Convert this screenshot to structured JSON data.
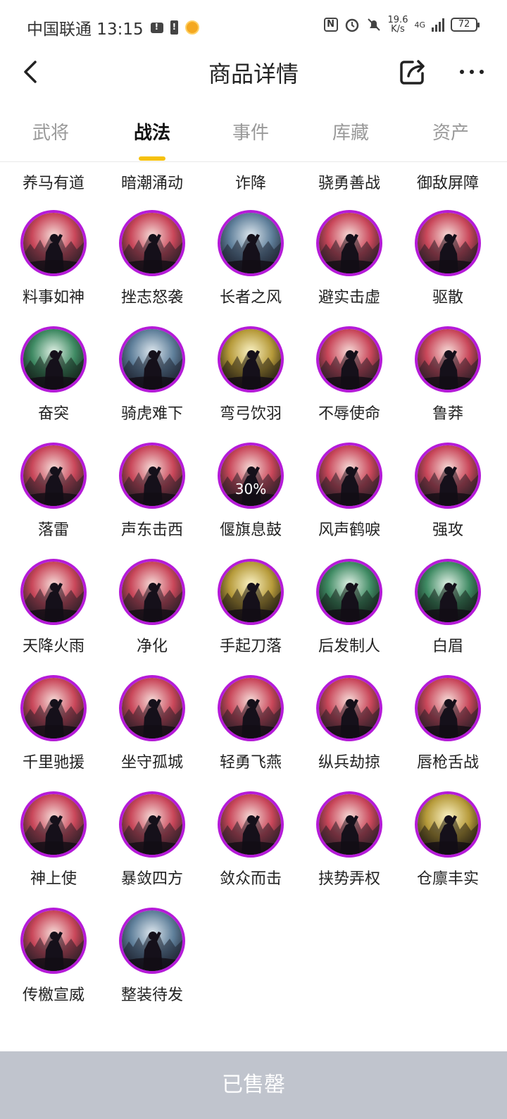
{
  "status_bar": {
    "carrier_time": "中国联通 13:15",
    "speed_value": "19.6",
    "speed_unit": "K/s",
    "network": "4G",
    "battery": "72"
  },
  "header": {
    "title": "商品详情"
  },
  "tabs": [
    {
      "label": "武将"
    },
    {
      "label": "战法"
    },
    {
      "label": "事件"
    },
    {
      "label": "库藏"
    },
    {
      "label": "资产"
    }
  ],
  "active_tab": "战法",
  "partial_row": [
    "养马有道",
    "暗潮涌动",
    "诈降",
    "骁勇善战",
    "御敌屏障"
  ],
  "skills": [
    {
      "name": "料事如神",
      "theme": "red"
    },
    {
      "name": "挫志怒袭",
      "theme": "red"
    },
    {
      "name": "长者之风",
      "theme": "blue"
    },
    {
      "name": "避实击虚",
      "theme": "red"
    },
    {
      "name": "驱散",
      "theme": "red"
    },
    {
      "name": "奋突",
      "theme": "green"
    },
    {
      "name": "骑虎难下",
      "theme": "blue"
    },
    {
      "name": "弯弓饮羽",
      "theme": "gold"
    },
    {
      "name": "不辱使命",
      "theme": "red"
    },
    {
      "name": "鲁莽",
      "theme": "red"
    },
    {
      "name": "落雷",
      "theme": "red"
    },
    {
      "name": "声东击西",
      "theme": "red"
    },
    {
      "name": "偃旗息鼓",
      "theme": "red",
      "badge": "30%"
    },
    {
      "name": "风声鹤唳",
      "theme": "red"
    },
    {
      "name": "强攻",
      "theme": "red"
    },
    {
      "name": "天降火雨",
      "theme": "red"
    },
    {
      "name": "净化",
      "theme": "red"
    },
    {
      "name": "手起刀落",
      "theme": "gold"
    },
    {
      "name": "后发制人",
      "theme": "green"
    },
    {
      "name": "白眉",
      "theme": "green"
    },
    {
      "name": "千里驰援",
      "theme": "red"
    },
    {
      "name": "坐守孤城",
      "theme": "red"
    },
    {
      "name": "轻勇飞燕",
      "theme": "red"
    },
    {
      "name": "纵兵劫掠",
      "theme": "red"
    },
    {
      "name": "唇枪舌战",
      "theme": "red"
    },
    {
      "name": "神上使",
      "theme": "red"
    },
    {
      "name": "暴敛四方",
      "theme": "red"
    },
    {
      "name": "敛众而击",
      "theme": "red"
    },
    {
      "name": "挟势弄权",
      "theme": "red"
    },
    {
      "name": "仓廪丰实",
      "theme": "gold"
    },
    {
      "name": "传檄宣威",
      "theme": "red"
    },
    {
      "name": "整装待发",
      "theme": "blue"
    }
  ],
  "colors": {
    "accent": "#f6c10c",
    "icon_border": "#b51bd8",
    "sold_bar": "#c0c4cd",
    "themes": {
      "red": [
        "#f6dcd8",
        "#c9475a",
        "#2a1e26"
      ],
      "blue": [
        "#dfe8ef",
        "#5f7f9a",
        "#1e2230"
      ],
      "green": [
        "#e2f1e6",
        "#3f8a63",
        "#14201a"
      ],
      "gold": [
        "#fbf3c6",
        "#b69a3a",
        "#231d12"
      ]
    }
  },
  "bottom": {
    "label": "已售罄"
  }
}
